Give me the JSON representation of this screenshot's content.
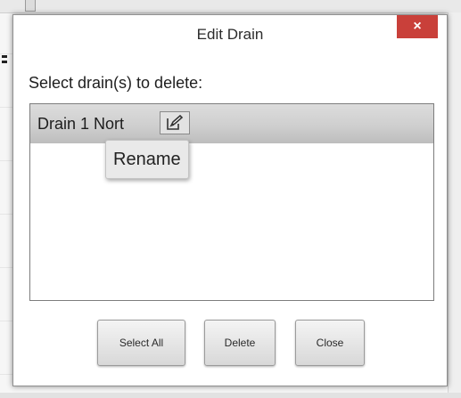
{
  "dialog": {
    "title": "Edit Drain",
    "close_glyph": "×",
    "prompt": "Select drain(s) to delete:",
    "list": {
      "items": [
        {
          "label": "Drain 1 Nort",
          "selected": true
        }
      ],
      "edit_icon": "edit-pencil-icon"
    },
    "tooltip": "Rename",
    "buttons": {
      "select_all": "Select All",
      "delete": "Delete",
      "close": "Close"
    }
  },
  "colors": {
    "close_button": "#c9403a",
    "selected_row": "#cfcfcf"
  }
}
